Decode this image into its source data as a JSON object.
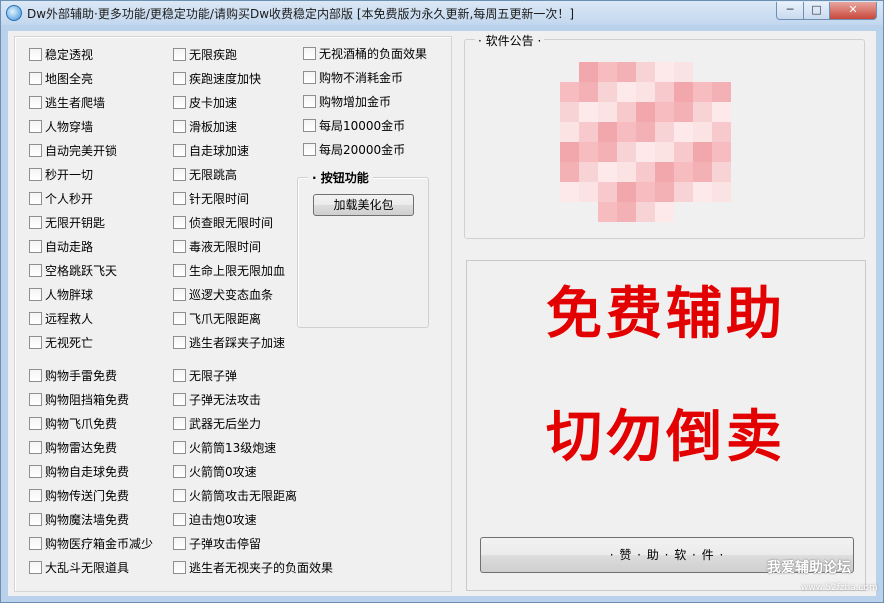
{
  "window": {
    "title": "Dw外部辅助·更多功能/更稳定功能/请购买Dw收费稳定内部版 [本免费版为永久更新,每周五更新一次！]",
    "minimize": "─",
    "maximize": "□",
    "close": "✕"
  },
  "features": {
    "col1": [
      "稳定透视",
      "地图全亮",
      "逃生者爬墙",
      "人物穿墙",
      "自动完美开锁",
      "秒开一切",
      "个人秒开",
      "无限开钥匙",
      "自动走路",
      "空格跳跃飞天",
      "人物胖球",
      "远程救人",
      "无视死亡"
    ],
    "col2": [
      "无限疾跑",
      "疾跑速度加快",
      "皮卡加速",
      "滑板加速",
      "自走球加速",
      "无限跳高",
      "针无限时间",
      "侦查眼无限时间",
      "毒液无限时间",
      "生命上限无限加血",
      "巡逻犬变态血条",
      "飞爪无限距离",
      "逃生者踩夹子加速"
    ],
    "col3": [
      "无视酒桶的负面效果",
      "购物不消耗金币",
      "购物增加金币",
      "每局10000金币",
      "每局20000金币"
    ],
    "col4": [
      "购物手雷免费",
      "购物阻挡箱免费",
      "购物飞爪免费",
      "购物雷达免费",
      "购物自走球免费",
      "购物传送门免费",
      "购物魔法墙免费",
      "购物医疗箱金币减少",
      "大乱斗无限道具"
    ],
    "col5": [
      "无限子弹",
      "子弹无法攻击",
      "武器无后坐力",
      "火箭筒13级炮速",
      "火箭筒0攻速",
      "火箭筒攻击无限距离",
      "迫击炮0攻速",
      "子弹攻击停留",
      "逃生者无视夹子的负面效果"
    ]
  },
  "button_group": {
    "title": "· 按钮功能",
    "load_skin_button": "加载美化包"
  },
  "notice": {
    "title": "· 软件公告 ·"
  },
  "promo": {
    "line1": "免费辅助",
    "line2": "切勿倒卖",
    "sponsor_button": "· 赞 · 助 · 软 · 件 ·"
  },
  "watermark": {
    "text": "我爱辅助论坛",
    "url": "www.52fzha.com"
  },
  "colors": {
    "promo_red": "#e30000",
    "window_frame": "#b9d1ea",
    "panel_bg": "#f0f0f0"
  }
}
